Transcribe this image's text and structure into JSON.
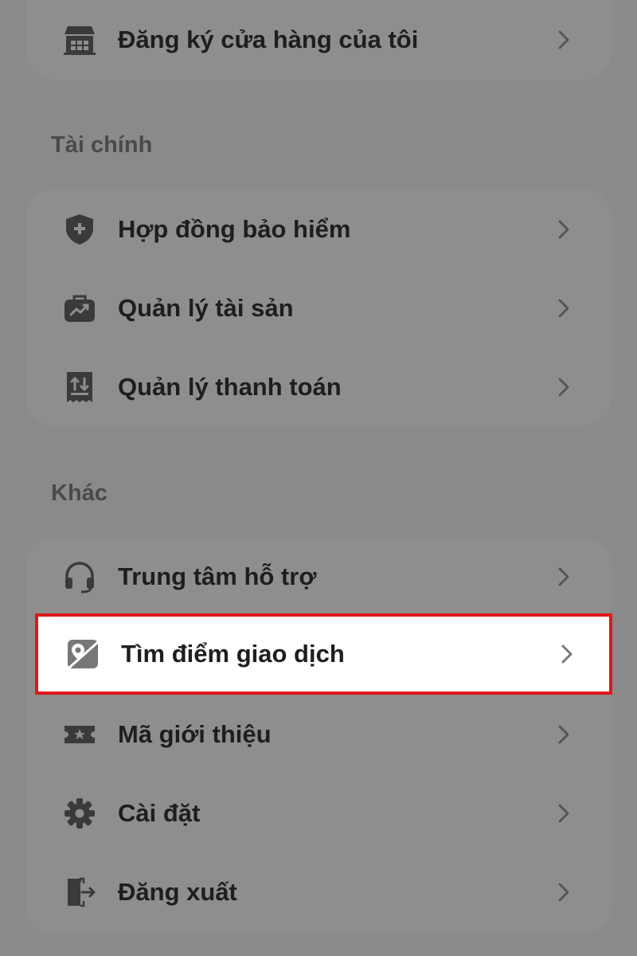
{
  "top_card": {
    "items": [
      {
        "label": "Đăng ký cửa hàng của tôi",
        "icon": "store-icon"
      }
    ]
  },
  "finance": {
    "title": "Tài chính",
    "items": [
      {
        "label": "Hợp đồng bảo hiểm",
        "icon": "shield-plus-icon"
      },
      {
        "label": "Quản lý tài sản",
        "icon": "briefcase-chart-icon"
      },
      {
        "label": "Quản lý thanh toán",
        "icon": "receipt-icon"
      }
    ]
  },
  "other": {
    "title": "Khác",
    "items": [
      {
        "label": "Trung tâm hỗ trợ",
        "icon": "headset-icon"
      },
      {
        "label": "Tìm điểm giao dịch",
        "icon": "map-pin-icon",
        "highlighted": true
      },
      {
        "label": "Mã giới thiệu",
        "icon": "ticket-star-icon"
      },
      {
        "label": "Cài đặt",
        "icon": "gear-icon"
      },
      {
        "label": "Đăng xuất",
        "icon": "logout-icon"
      }
    ]
  },
  "colors": {
    "overlay": "#8a8a8a",
    "highlight_border": "#e01818",
    "highlight_bg": "#ffffff",
    "text": "#1e1e1e"
  }
}
